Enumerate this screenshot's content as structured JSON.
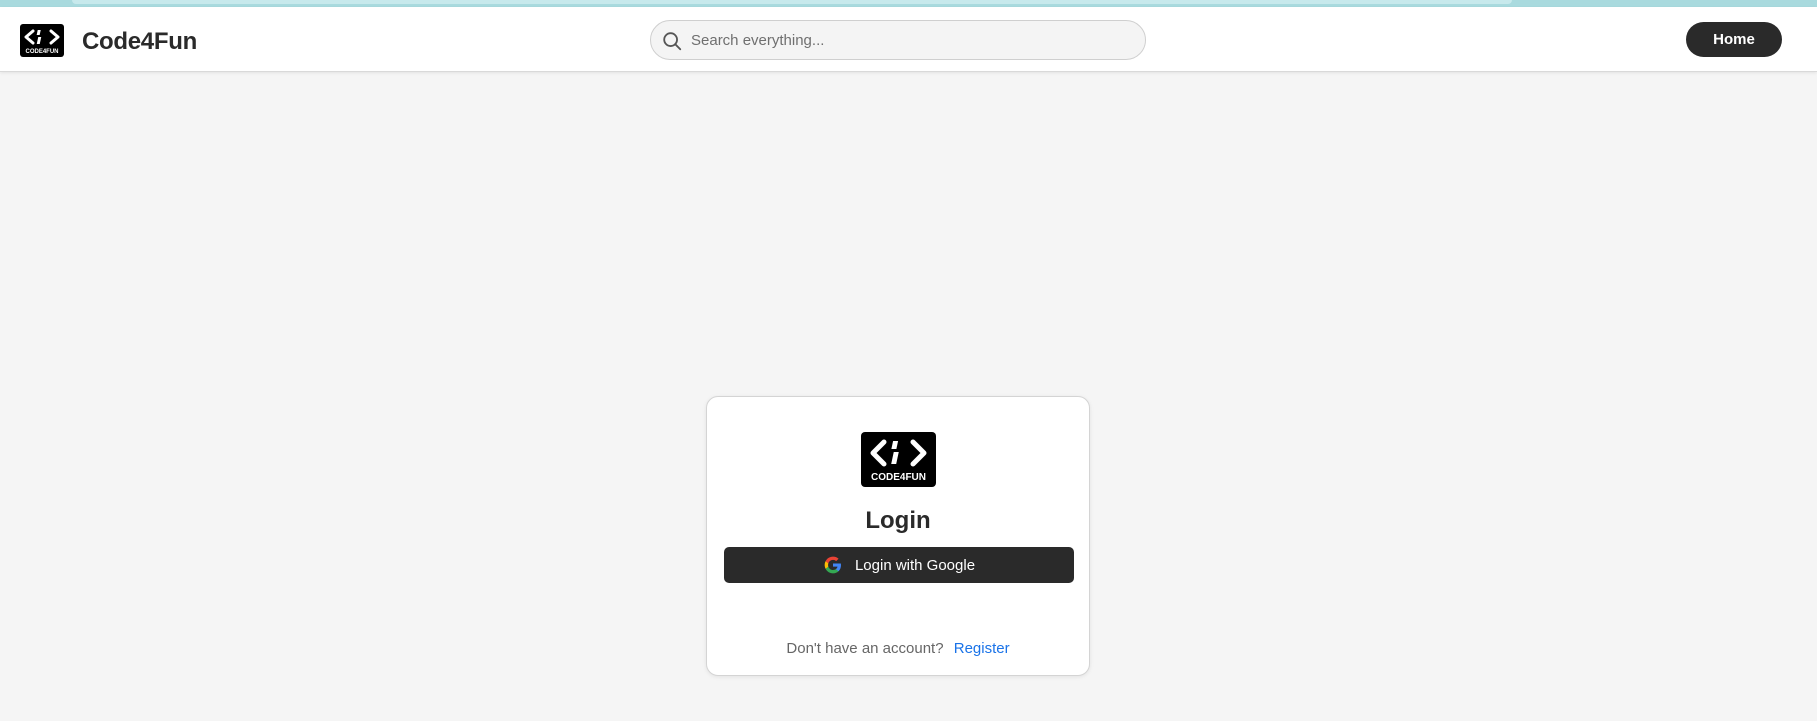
{
  "header": {
    "brand": "Code4Fun",
    "logo_text": "CODE4FUN",
    "search_placeholder": "Search everything...",
    "home_label": "Home"
  },
  "login": {
    "logo_text": "CODE4FUN",
    "title": "Login",
    "google_button_label": "Login with Google",
    "no_account_text": "Don't have an account?",
    "register_link": "Register"
  },
  "icons": {
    "search": "search-icon",
    "google": "google-icon",
    "logo": "code-brackets-logo"
  },
  "colors": {
    "accent_bar": "#a9dade",
    "button_dark": "#2a2a2a",
    "link": "#1a73e8",
    "page_bg": "#f5f5f5"
  }
}
